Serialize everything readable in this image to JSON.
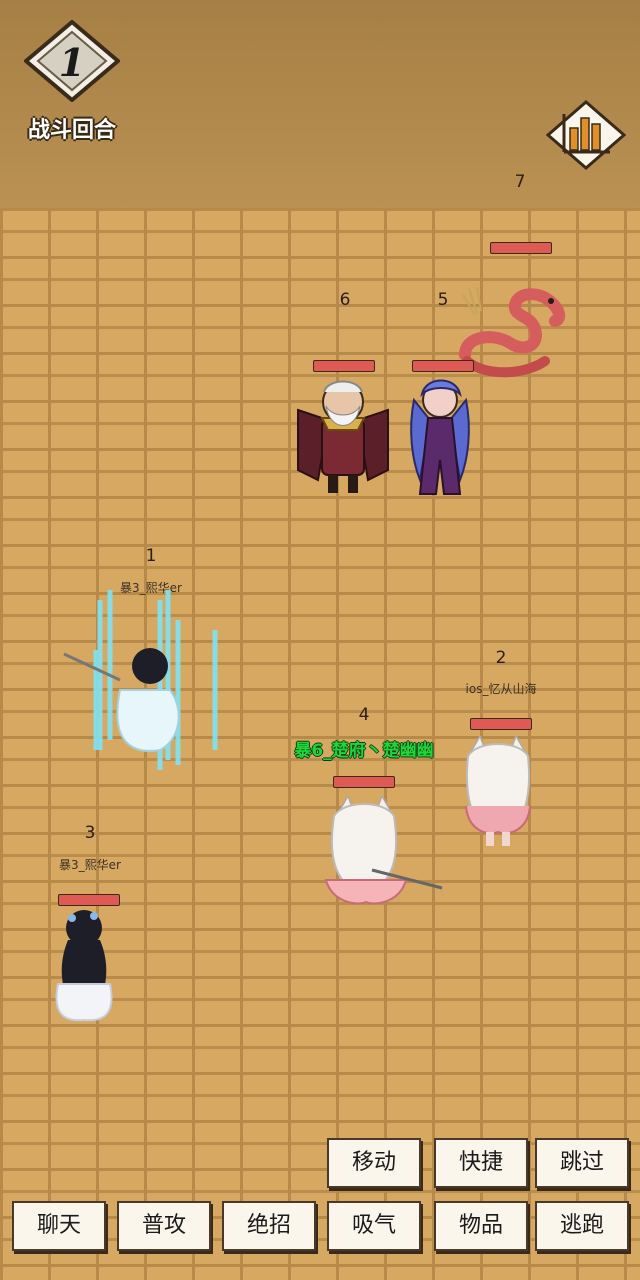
{
  "battle": {
    "round_number": "1",
    "round_label": "战斗回合"
  },
  "colors": {
    "hp_bar": "#e05a55",
    "highlight_name": "#1fd63a",
    "brick": "#d6a862",
    "header": "#b08a4f"
  },
  "enemies": [
    {
      "slot": "7",
      "hp": 1.0
    },
    {
      "slot": "6",
      "hp": 1.0
    },
    {
      "slot": "5",
      "hp": 1.0
    }
  ],
  "allies": [
    {
      "slot": "1",
      "name": "暴3_熙华er",
      "hp": 1.0
    },
    {
      "slot": "2",
      "name": "ios_忆从山海",
      "hp": 1.0
    },
    {
      "slot": "3",
      "name": "暴3_熙华er",
      "hp": 1.0
    },
    {
      "slot": "4",
      "name": "暴6_楚府丶楚幽幽",
      "hp": 1.0
    }
  ],
  "actions": {
    "move": "移动",
    "shortcut": "快捷",
    "skip": "跳过",
    "chat": "聊天",
    "attack": "普攻",
    "ultimate": "绝招",
    "breathe": "吸气",
    "items": "物品",
    "flee": "逃跑"
  },
  "icons": {
    "round": "round-diamond-icon",
    "stats": "bar-chart-icon"
  }
}
